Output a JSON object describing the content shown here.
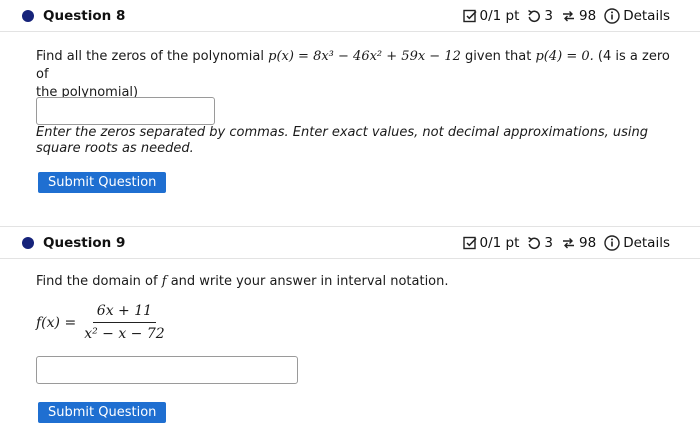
{
  "questions": [
    {
      "title": "Question 8",
      "score": "0/1 pt",
      "retries": "3",
      "attempts": "98",
      "details_label": "Details",
      "prompt_pre": "Find all the zeros of the polynomial",
      "prompt_poly": "p(x) = 8x³ − 46x² + 59x − 12",
      "prompt_mid": "given that",
      "prompt_cond": "p(4) = 0.",
      "prompt_post": "(4 is a zero of",
      "prompt_line2": "the polynomial)",
      "answer_value": "",
      "instructions": "Enter the zeros separated by commas. Enter exact values, not decimal approximations, using square roots as needed.",
      "submit_label": "Submit Question"
    },
    {
      "title": "Question 9",
      "score": "0/1 pt",
      "retries": "3",
      "attempts": "98",
      "details_label": "Details",
      "prompt_pre": "Find the domain of",
      "prompt_var": "f",
      "prompt_post": "and write your answer in interval notation.",
      "func_lhs": "f(x) =",
      "func_num": "6x + 11",
      "func_den": "x² − x − 72",
      "answer_value": "",
      "submit_label": "Submit Question"
    }
  ]
}
